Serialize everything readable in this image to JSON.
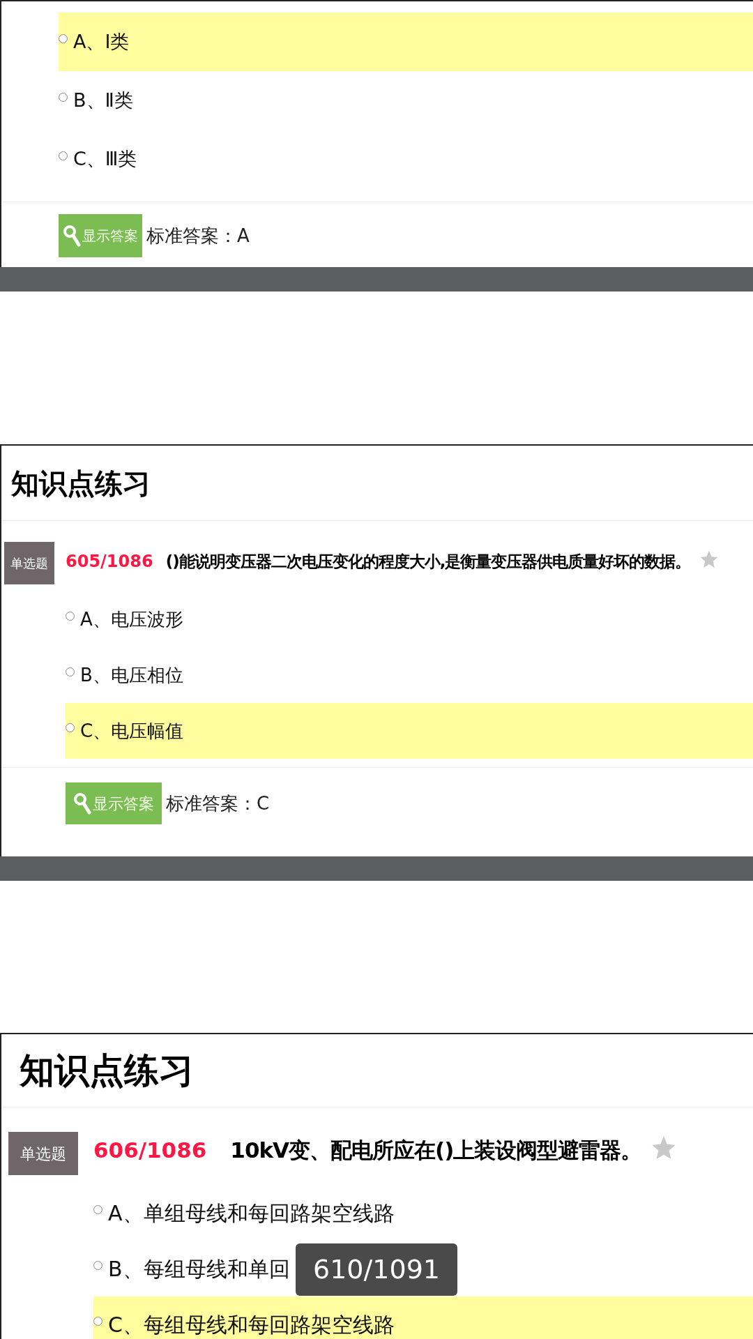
{
  "panels": [
    {
      "options": [
        {
          "text": "A、Ⅰ类",
          "highlighted": true
        },
        {
          "text": "B、Ⅱ类",
          "highlighted": false
        },
        {
          "text": "C、Ⅲ类",
          "highlighted": false
        }
      ],
      "show_answer_button": "显示答案",
      "answer": "标准答案：A"
    },
    {
      "title": "知识点练习",
      "badge": "单选题",
      "number": "605/1086",
      "question": "()能说明变压器二次电压变化的程度大小,是衡量变压器供电质量好坏的数据。",
      "options": [
        {
          "text": "A、电压波形",
          "highlighted": false
        },
        {
          "text": "B、电压相位",
          "highlighted": false
        },
        {
          "text": "C、电压幅值",
          "highlighted": true
        }
      ],
      "show_answer_button": "显示答案",
      "answer": "标准答案：C"
    },
    {
      "title": "知识点练习",
      "badge": "单选题",
      "number": "606/1086",
      "question": "10kV变、配电所应在()上装设阀型避雷器。",
      "options": [
        {
          "text": "A、单组母线和每回路架空线路",
          "highlighted": false
        },
        {
          "text": "B、每组母线和单回",
          "highlighted": false
        },
        {
          "text": "C、每组母线和每回路架空线路",
          "highlighted": true
        }
      ]
    }
  ],
  "page_counter": "610/1091"
}
